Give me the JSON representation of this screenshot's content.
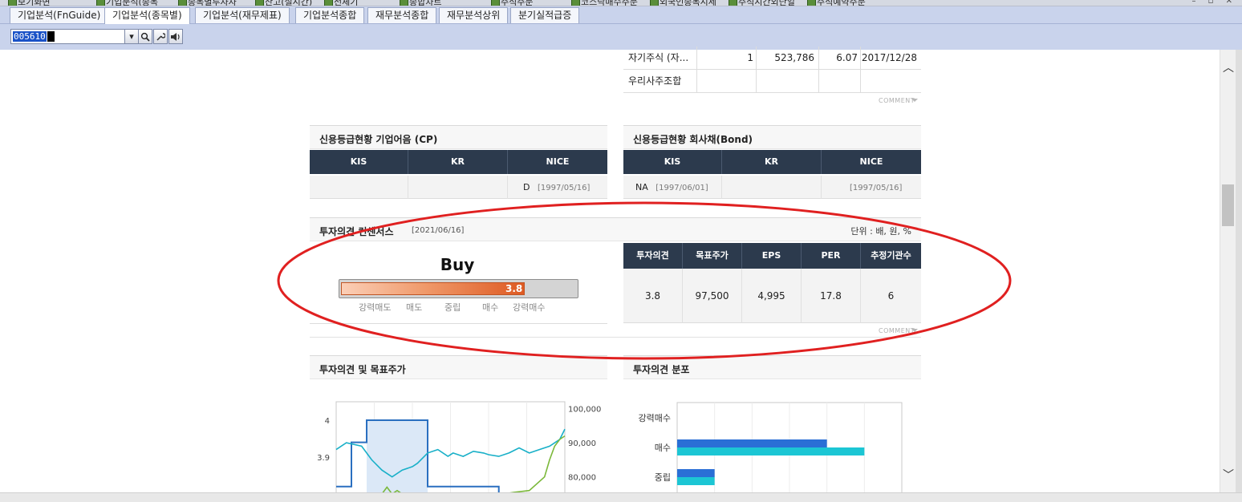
{
  "window": {
    "top_tabs": [
      "보기화면",
      "기업분석(종목",
      "종목별투자자",
      "잔고(실시간)",
      "전체기",
      "종합차트",
      "주식주문",
      "코스닥매수주문",
      "외국인종목시세",
      "주식시간외단일",
      "주식예약주문"
    ]
  },
  "tabs": [
    "기업분석(FnGuide)",
    "기업분석(종목별)",
    "기업분석(재무제표)",
    "기업분석종합",
    "재무분석종합",
    "재무분석상위",
    "분기실적급증"
  ],
  "active_tab_index": 1,
  "toolbar": {
    "stock_code": "005610",
    "dropdown_icon": "chevron-down-icon",
    "search_icon": "search-icon",
    "tool_icon": "wrench-icon",
    "speaker_icon": "speaker-icon"
  },
  "shareholders": {
    "rows": [
      {
        "name": "자기주식 (자...",
        "count": "1",
        "shares": "523,786",
        "ratio": "6.07",
        "date": "2017/12/28"
      },
      {
        "name": "우리사주조합",
        "count": "",
        "shares": "",
        "ratio": "",
        "date": ""
      }
    ],
    "comment_label": "COMMENT"
  },
  "credit_cp": {
    "title": "신용등급현황 기업어음 (CP)",
    "headers": [
      "KIS",
      "KR",
      "NICE"
    ],
    "cells": [
      {
        "grade": "",
        "date": ""
      },
      {
        "grade": "",
        "date": ""
      },
      {
        "grade": "D",
        "date": "[1997/05/16]"
      }
    ]
  },
  "credit_bond": {
    "title": "신용등급현황 회사채(Bond)",
    "headers": [
      "KIS",
      "KR",
      "NICE"
    ],
    "cells": [
      {
        "grade": "NA",
        "date": "[1997/06/01]"
      },
      {
        "grade": "",
        "date": ""
      },
      {
        "grade": "",
        "date": "[1997/05/16]"
      }
    ]
  },
  "consensus": {
    "title": "투자의견 컨센서스",
    "date": "[2021/06/16]",
    "unit": "단위 : 배, 원, %",
    "opinion": "Buy",
    "score": 3.8,
    "score_label": "3.8",
    "scale_labels": [
      "강력매도",
      "매도",
      "중립",
      "매수",
      "강력매수"
    ],
    "headers": [
      "투자의견",
      "목표주가",
      "EPS",
      "PER",
      "추정기관수"
    ],
    "values": [
      "3.8",
      "97,500",
      "4,995",
      "17.8",
      "6"
    ],
    "comment_label": "COMMENT",
    "highlight_color": "#e02020"
  },
  "opinion_chart": {
    "title": "투자의견 및 목표주가"
  },
  "distribution_chart": {
    "title": "투자의견 분포"
  },
  "chart_data": [
    {
      "type": "line",
      "title": "투자의견 및 목표주가",
      "y_left": {
        "ticks": [
          "4",
          "3.9"
        ],
        "range": [
          3.8,
          4.05
        ]
      },
      "y_right": {
        "ticks": [
          "100,000",
          "90,000",
          "80,000"
        ],
        "range": [
          75000,
          102000
        ]
      },
      "series": [
        {
          "axis": "left",
          "color": "#2a6fc0",
          "x": [
            0,
            3,
            3,
            6,
            6,
            18,
            18,
            21,
            21,
            22,
            23,
            24,
            29,
            32,
            32,
            45
          ],
          "values": [
            3.82,
            3.82,
            3.94,
            3.94,
            4.0,
            4.0,
            3.82,
            3.82,
            3.82,
            3.82,
            3.82,
            3.82,
            3.82,
            3.82,
            3.75,
            3.75
          ]
        },
        {
          "axis": "right",
          "color": "#19b0c8",
          "x": [
            0,
            2,
            5,
            7,
            9,
            11,
            13,
            15,
            16,
            18,
            20,
            22,
            23,
            25,
            27,
            29,
            30,
            32,
            34,
            36,
            38,
            40,
            42,
            44,
            45
          ],
          "values": [
            88000,
            90000,
            89000,
            85000,
            82000,
            80000,
            82000,
            83000,
            84000,
            87000,
            88000,
            86000,
            87000,
            86000,
            87500,
            87000,
            86500,
            86000,
            87000,
            88500,
            87000,
            88000,
            89000,
            91000,
            94000
          ]
        },
        {
          "axis": "right",
          "color": "#7bb83a",
          "x": [
            0,
            5,
            9,
            10,
            11,
            12,
            13,
            15,
            18,
            20,
            22,
            24,
            26,
            28,
            30,
            33,
            35,
            38,
            41,
            42,
            43,
            44,
            45
          ],
          "values": [
            75000,
            75000,
            75000,
            77000,
            75000,
            76000,
            75000,
            75000,
            75000,
            75000,
            75000,
            75000,
            75000,
            75000,
            75000,
            75000,
            75500,
            76000,
            80000,
            85000,
            89000,
            91000,
            92000
          ]
        }
      ]
    },
    {
      "type": "bar",
      "title": "투자의견 분포",
      "categories": [
        "강력매수",
        "매수",
        "중립"
      ],
      "series": [
        {
          "color": "#2a6fd6",
          "values": [
            0,
            4,
            1
          ]
        },
        {
          "color": "#1cc6d4",
          "values": [
            0,
            5,
            1
          ]
        }
      ],
      "xlim": [
        0,
        6
      ]
    }
  ]
}
